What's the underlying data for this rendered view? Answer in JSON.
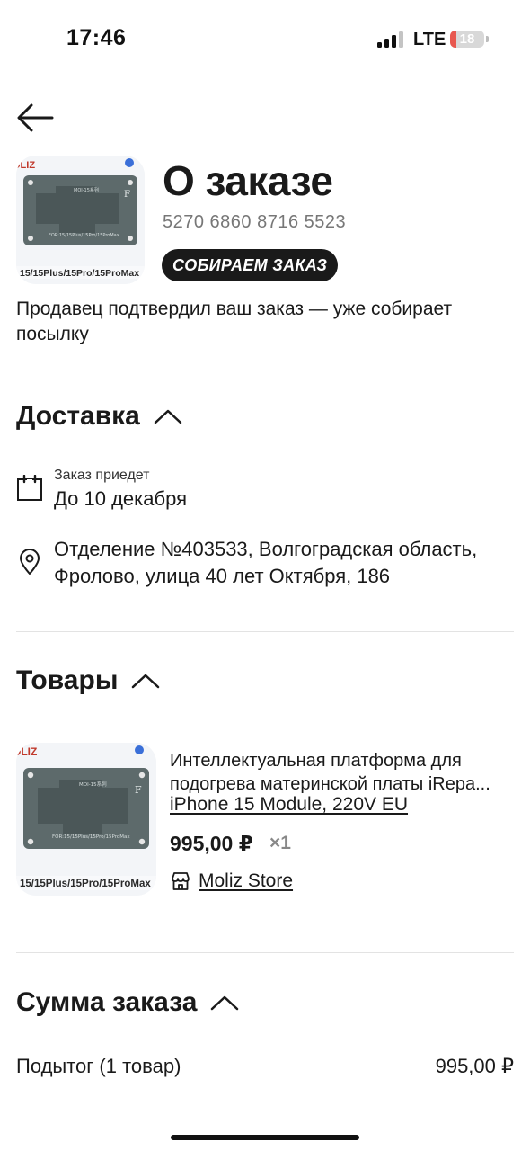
{
  "status_bar": {
    "time": "17:46",
    "network": "LTE",
    "battery_level": "18",
    "battery_fraction": 0.18,
    "signal_bars_active": 3,
    "signal_bars_total": 4,
    "colors": {
      "battery_low": "#e8584f",
      "text": "#111111"
    }
  },
  "header": {
    "back_icon": "arrow-left-icon"
  },
  "order": {
    "title": "О заказе",
    "number": "5270 6860 8716 5523",
    "status": "СОБИРАЕМ ЗАКАЗ",
    "status_description": "Продавец подтвердил ваш заказ — уже собирает посылку",
    "product_image_text": {
      "brand": "OLIZ",
      "model": "MOI-15系列",
      "letter": "F",
      "compat": "FOR:15/15Plus/15Pro/15ProMax",
      "caption": "15/15Plus/15Pro/15ProMax"
    }
  },
  "delivery": {
    "section_title": "Доставка",
    "arrival_label": "Заказ приедет",
    "arrival_value": "До 10 декабря",
    "address": "Отделение №403533, Волгоградская область, Фролово, улица 40 лет Октября, 186",
    "icons": {
      "date": "calendar-icon",
      "address": "location-pin-icon",
      "toggle": "chevron-up-icon"
    }
  },
  "goods": {
    "section_title": "Товары",
    "items": [
      {
        "name": "Интеллектуальная платформа для подогрева материнской платы iRepa...",
        "variant": "iPhone 15 Module, 220V EU",
        "price": "995,00 ₽",
        "quantity": "×1",
        "store": "Moliz Store",
        "store_icon": "store-icon",
        "image_text": {
          "brand": "OLIZ",
          "model": "MOI-15系列",
          "letter": "F",
          "compat": "FOR:15/15Plus/15Pro/15ProMax",
          "caption": "15/15Plus/15Pro/15ProMax"
        }
      }
    ]
  },
  "summary": {
    "section_title": "Сумма заказа",
    "subtotal_label": "Подытог (1 товар)",
    "subtotal_value": "995,00 ₽"
  },
  "colors": {
    "badge_bg": "#1a1a1a",
    "badge_text": "#ffffff",
    "muted_text": "#777777",
    "divider": "#e3e3e3"
  }
}
